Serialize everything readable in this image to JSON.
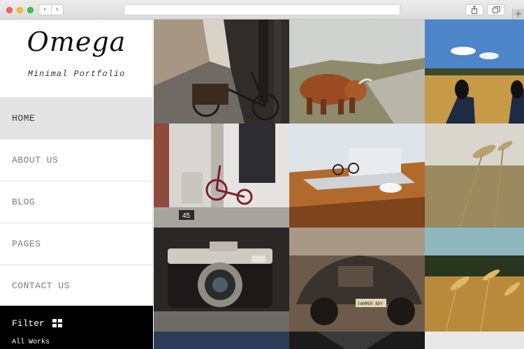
{
  "browser": {
    "back_icon": "chevron-left-icon",
    "forward_icon": "chevron-right-icon",
    "share_icon": "share-icon",
    "tabs_icon": "tabs-overview-icon",
    "new_tab_icon": "plus-icon",
    "back_glyph": "‹",
    "forward_glyph": "›",
    "new_tab_glyph": "+"
  },
  "sidebar": {
    "logo": "Omega",
    "tagline": "Minimal Portfolio",
    "menu": [
      {
        "label": "HOME",
        "active": true
      },
      {
        "label": "ABOUT US",
        "active": false
      },
      {
        "label": "BLOG",
        "active": false
      },
      {
        "label": "PAGES",
        "active": false
      },
      {
        "label": "CONTACT US",
        "active": false
      }
    ],
    "filter": {
      "title": "Filter",
      "icon": "grid-icon",
      "current": "All Works"
    }
  },
  "gallery": {
    "photos": [
      {
        "subject": "city-street-bicycle"
      },
      {
        "subject": "highland-cow"
      },
      {
        "subject": "feet-in-field"
      },
      {
        "subject": "tricycle-doorway",
        "sign": "45"
      },
      {
        "subject": "laptop-glasses-mouse"
      },
      {
        "subject": "wheat-closeup"
      },
      {
        "subject": "vintage-camera"
      },
      {
        "subject": "vintage-car",
        "plate": "FARMER BOY"
      },
      {
        "subject": "wheat-field"
      }
    ]
  },
  "colors": {
    "active_menu_bg": "#e3e3e3",
    "filter_bg": "#000000",
    "sidebar_bg": "#ffffff"
  }
}
